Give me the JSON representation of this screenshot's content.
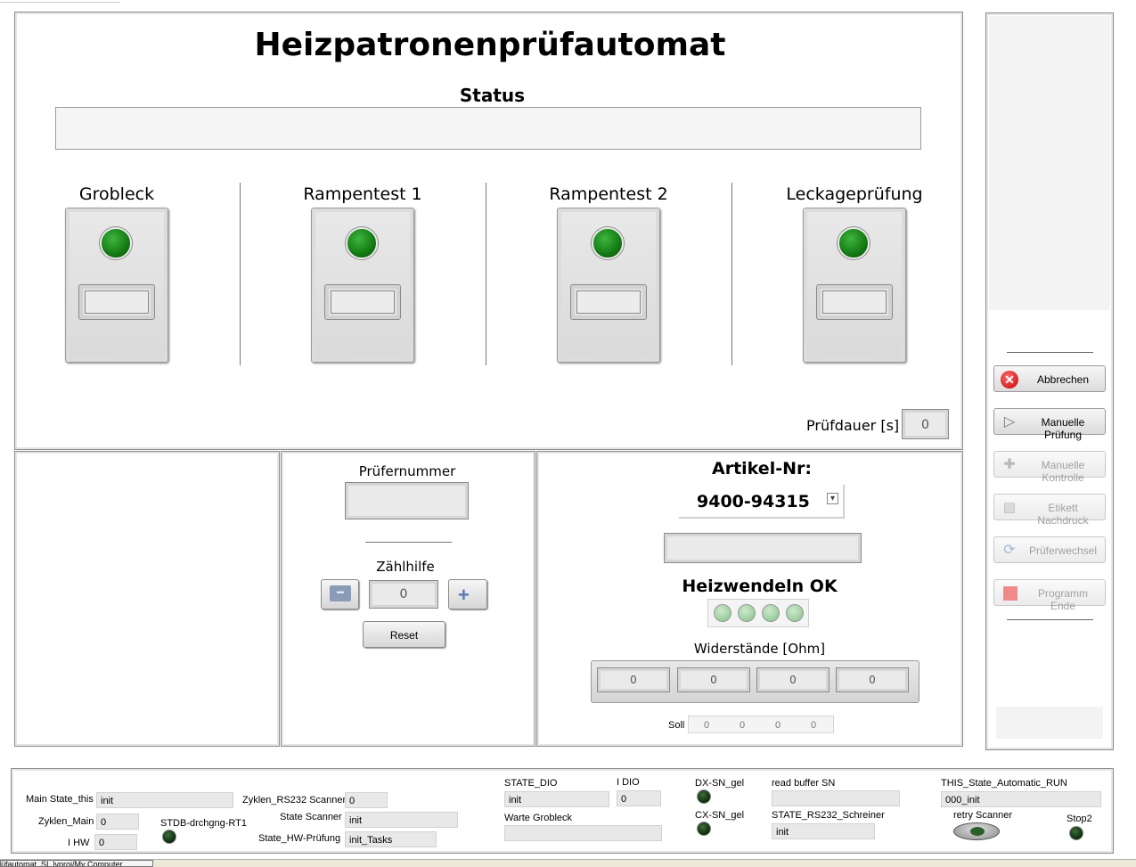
{
  "header": {
    "title": "Heizpatronenprüfautomat",
    "status_label": "Status",
    "status_value": ""
  },
  "tests": [
    {
      "label": "Grobleck",
      "led": "on",
      "value": ""
    },
    {
      "label": "Rampentest 1",
      "led": "on",
      "value": ""
    },
    {
      "label": "Rampentest 2",
      "led": "on",
      "value": ""
    },
    {
      "label": "Leckageprüfung",
      "led": "on",
      "value": ""
    }
  ],
  "pruefdauer": {
    "label": "Prüfdauer [s]",
    "value": "0"
  },
  "pruefer": {
    "label": "Prüfernummer",
    "value": "",
    "counter_label": "Zählhilfe",
    "counter_value": "0",
    "minus": "−",
    "plus": "+",
    "reset_label": "Reset"
  },
  "artikel": {
    "label": "Artikel-Nr:",
    "value": "9400-94315",
    "dropdown_icon": "▾",
    "secondary_value": "",
    "heizwendeln_label": "Heizwendeln OK",
    "heizwendeln_leds": 4,
    "widerstaende_label": "Widerstände [Ohm]",
    "widerstaende": [
      "0",
      "0",
      "0",
      "0"
    ],
    "soll_label": "Soll",
    "soll": [
      "0",
      "0",
      "0",
      "0"
    ]
  },
  "sidebar": {
    "buttons": [
      {
        "label": "Abbrechen",
        "icon": "cancel-icon",
        "enabled": true
      },
      {
        "label": "Manuelle Prüfung",
        "icon": "play-icon",
        "enabled": true
      },
      {
        "label": "Manuelle Kontrolle",
        "icon": "tools-icon",
        "enabled": false
      },
      {
        "label": "Etikett Nachdruck",
        "icon": "printer-icon",
        "enabled": false
      },
      {
        "label": "Prüferwechsel",
        "icon": "refresh-icon",
        "enabled": false
      },
      {
        "label": "Programm Ende",
        "icon": "stop-icon",
        "enabled": false
      }
    ]
  },
  "debug": {
    "main_state_label": "Main State_this",
    "main_state": "init",
    "zyklen_main_label": "Zyklen_Main",
    "zyklen_main": "0",
    "ihw_label": "I HW",
    "ihw": "0",
    "stdb_label": "STDB-drchgng-RT1",
    "zyklen_rs232_label": "Zyklen_RS232 Scanner",
    "zyklen_rs232": "0",
    "state_scanner_label": "State Scanner",
    "state_scanner": "init",
    "state_hw_label": "State_HW-Prüfung",
    "state_hw": "init_Tasks",
    "state_dio_label": "STATE_DIO",
    "state_dio": "init",
    "idio_label": "I DIO",
    "idio": "0",
    "warte_label": "Warte Grobleck",
    "warte": "",
    "dx_label": "DX-SN_gel",
    "cx_label": "CX-SN_gel",
    "readbuf_label": "read buffer SN",
    "readbuf": "",
    "state_rs232_label": "STATE_RS232_Schreiner",
    "state_rs232": "init",
    "this_state_label": "THIS_State_Automatic_RUN",
    "this_state": "000_init",
    "retry_label": "retry Scanner",
    "stop2_label": "Stop2"
  },
  "taskbar": {
    "text": "üfautomat_SI_lvproj/My Computer"
  }
}
